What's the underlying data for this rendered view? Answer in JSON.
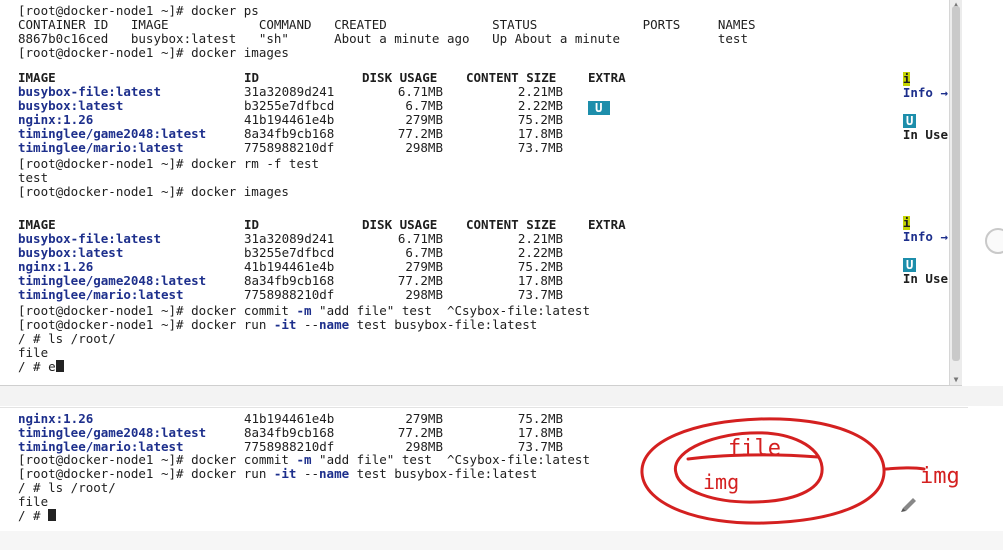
{
  "top": {
    "lines": [
      {
        "t": "prompt",
        "cmd": "docker ps",
        "text": "[root@docker-node1 ~]# docker ps"
      },
      {
        "t": "text",
        "text": "CONTAINER ID   IMAGE            COMMAND   CREATED              STATUS              PORTS     NAMES"
      },
      {
        "t": "text",
        "text": "8867b0c16ced   busybox:latest   \"sh\"      About a minute ago   Up About a minute             test"
      },
      {
        "t": "prompt",
        "cmd": "docker images",
        "text": "[root@docker-node1 ~]# docker images"
      }
    ],
    "info_bar": {
      "mark": "i",
      "info": "Info →",
      "badge": "U",
      "in_use": "In Use"
    },
    "images_header": {
      "image": "IMAGE",
      "id": "ID",
      "disk": "DISK USAGE",
      "content": "CONTENT SIZE",
      "extra": "EXTRA"
    },
    "images_1": [
      {
        "image": "busybox-file:latest",
        "id": "31a32089d241",
        "disk": "6.71MB",
        "content": "2.21MB",
        "extra": ""
      },
      {
        "image": "busybox:latest",
        "id": "b3255e7dfbcd",
        "disk": "6.7MB",
        "content": "2.22MB",
        "extra": "U"
      },
      {
        "image": "nginx:1.26",
        "id": "41b194461e4b",
        "disk": "279MB",
        "content": "75.2MB",
        "extra": ""
      },
      {
        "image": "timinglee/game2048:latest",
        "id": "8a34fb9cb168",
        "disk": "77.2MB",
        "content": "17.8MB",
        "extra": ""
      },
      {
        "image": "timinglee/mario:latest",
        "id": "7758988210df",
        "disk": "298MB",
        "content": "73.7MB",
        "extra": ""
      }
    ],
    "mid_lines": [
      {
        "text": "[root@docker-node1 ~]# docker rm -f test"
      },
      {
        "text": "test"
      },
      {
        "text": "[root@docker-node1 ~]# docker images"
      }
    ],
    "images_2": [
      {
        "image": "busybox-file:latest",
        "id": "31a32089d241",
        "disk": "6.71MB",
        "content": "2.21MB"
      },
      {
        "image": "busybox:latest",
        "id": "b3255e7dfbcd",
        "disk": "6.7MB",
        "content": "2.22MB"
      },
      {
        "image": "nginx:1.26",
        "id": "41b194461e4b",
        "disk": "279MB",
        "content": "75.2MB"
      },
      {
        "image": "timinglee/game2048:latest",
        "id": "8a34fb9cb168",
        "disk": "77.2MB",
        "content": "17.8MB"
      },
      {
        "image": "timinglee/mario:latest",
        "id": "7758988210df",
        "disk": "298MB",
        "content": "73.7MB"
      }
    ],
    "end_lines": {
      "commit": {
        "prompt": "[root@docker-node1 ~]# docker commit ",
        "flag": "-m",
        "rest": " \"add file\" test  ^Csybox-file:latest"
      },
      "run": {
        "prompt": "[root@docker-node1 ~]# docker run ",
        "flag1": "-it",
        "mid": " --",
        "flag2": "name",
        "rest": " test busybox-file:latest"
      },
      "ls": "/ # ls /root/",
      "out": "file",
      "typing": "/ # e"
    }
  },
  "bottom": {
    "images": [
      {
        "image": "nginx:1.26",
        "id": "41b194461e4b",
        "disk": "279MB",
        "content": "75.2MB"
      },
      {
        "image": "timinglee/game2048:latest",
        "id": "8a34fb9cb168",
        "disk": "77.2MB",
        "content": "17.8MB"
      },
      {
        "image": "timinglee/mario:latest",
        "id": "7758988210df",
        "disk": "298MB",
        "content": "73.7MB"
      }
    ],
    "end_lines": {
      "commit": {
        "prompt": "[root@docker-node1 ~]# docker commit ",
        "flag": "-m",
        "rest": " \"add file\" test  ^Csybox-file:latest"
      },
      "run": {
        "prompt": "[root@docker-node1 ~]# docker run ",
        "flag1": "-it",
        "mid": " --",
        "flag2": "name",
        "rest": " test busybox-file:latest"
      },
      "ls": "/ # ls /root/",
      "out": "file",
      "prompt": "/ # "
    }
  },
  "annotation": {
    "inner_top": "file",
    "inner_bottom": "img",
    "arrow_label": "img",
    "color": "#d42020"
  }
}
